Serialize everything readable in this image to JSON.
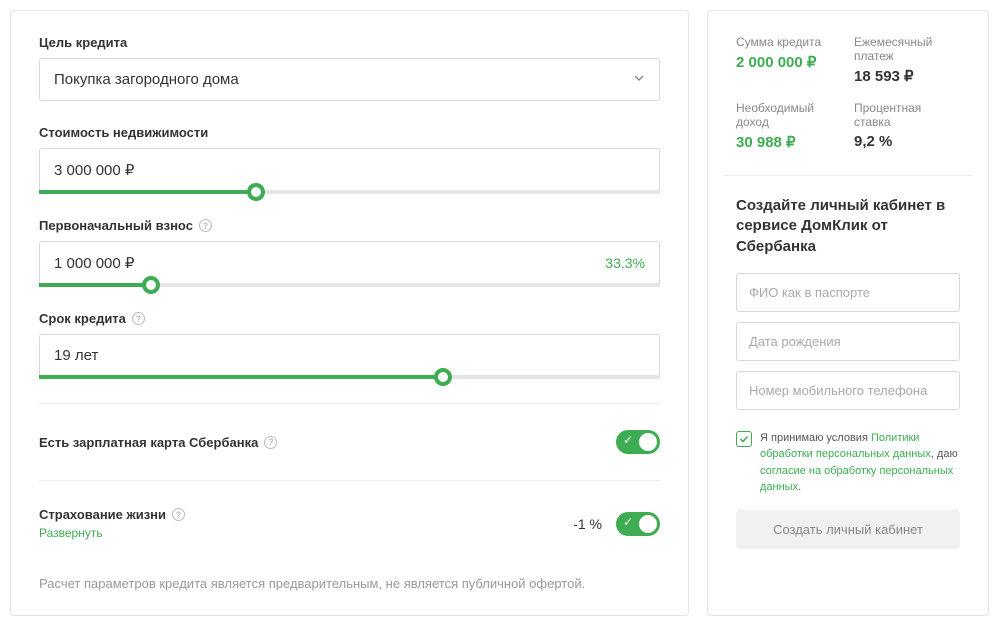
{
  "left": {
    "purpose": {
      "label": "Цель кредита",
      "value": "Покупка загородного дома"
    },
    "property_cost": {
      "label": "Стоимость недвижимости",
      "value": "3 000 000 ₽",
      "slider_pct": 35
    },
    "down_payment": {
      "label": "Первоначальный взнос",
      "value": "1 000 000 ₽",
      "pct": "33.3%",
      "slider_pct": 18
    },
    "term": {
      "label": "Срок кредита",
      "value": "19 лет",
      "slider_pct": 65
    },
    "salary_card": {
      "label": "Есть зарплатная карта Сбербанка",
      "on": true
    },
    "life_insurance": {
      "label": "Страхование жизни",
      "expand": "Развернуть",
      "delta": "-1 %",
      "on": true
    },
    "footnote": "Расчет параметров кредита является предварительным, не является публичной офертой."
  },
  "right": {
    "summary": {
      "loan_amount": {
        "label": "Сумма кредита",
        "value": "2 000 000 ₽"
      },
      "monthly_payment": {
        "label": "Ежемесячный платеж",
        "value": "18 593 ₽"
      },
      "required_income": {
        "label": "Необходимый доход",
        "value": "30 988 ₽"
      },
      "rate": {
        "label": "Процентная ставка",
        "value": "9,2 %"
      }
    },
    "cta_heading": "Создайте личный кабинет в сервисе ДомКлик от Сбербанка",
    "placeholders": {
      "name": "ФИО как в паспорте",
      "dob": "Дата рождения",
      "phone": "Номер мобильного телефона"
    },
    "consent": {
      "prefix": "Я принимаю условия ",
      "link1": "Политики обработки персональных данных",
      "mid": ", даю ",
      "link2": "согласие на обработку персональных данных",
      "suffix": "."
    },
    "submit": "Создать личный кабинет"
  }
}
